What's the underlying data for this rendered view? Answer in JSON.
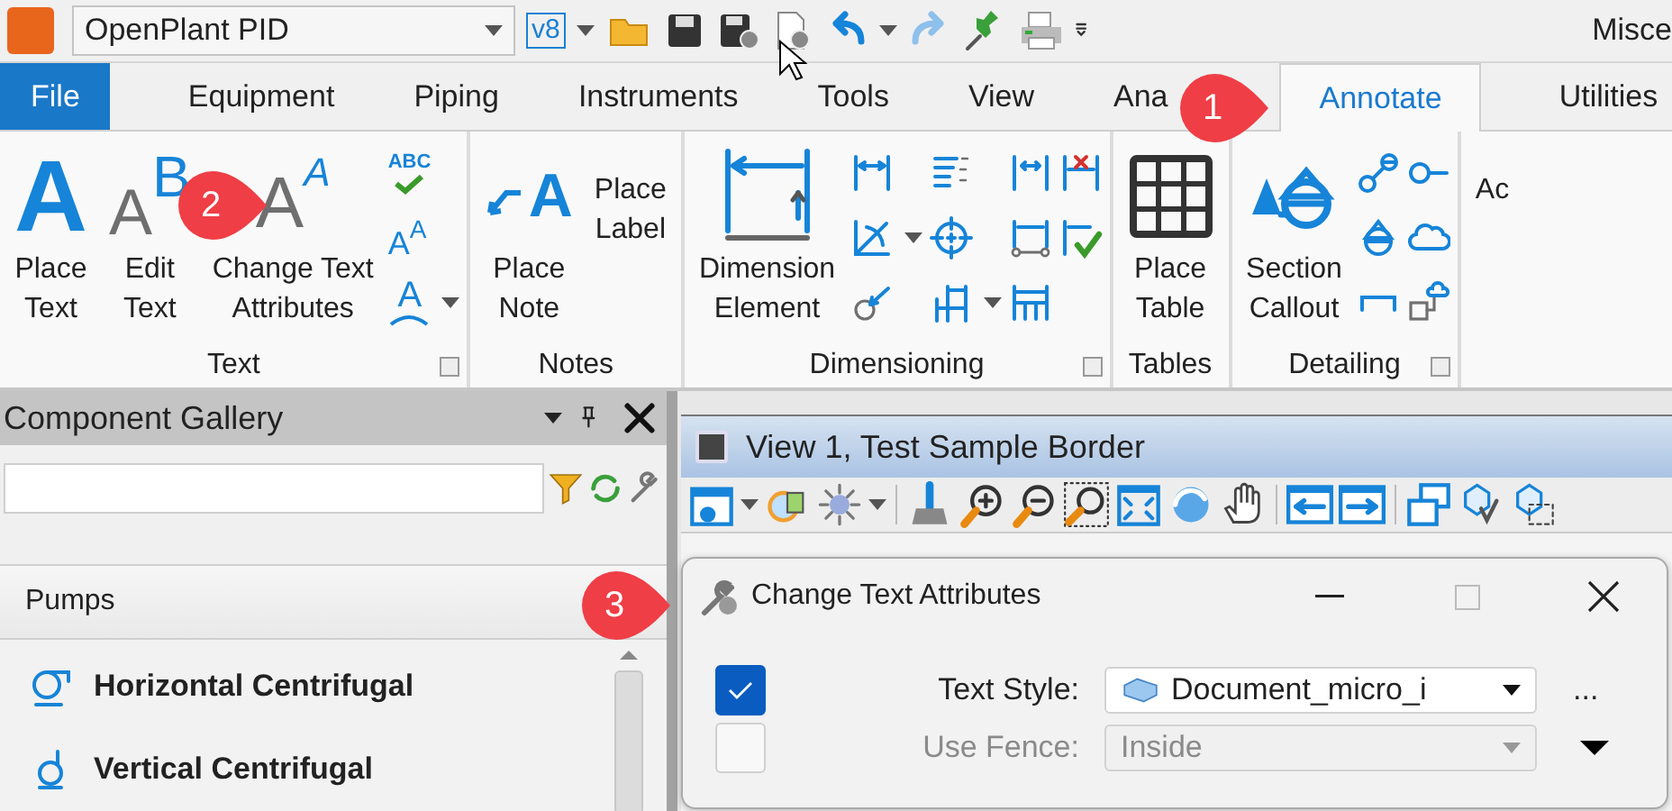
{
  "quick_access": {
    "workflow": "OpenPlant PID",
    "version_badge": "v8",
    "title_fragment": "Misce"
  },
  "ribbon_tabs": [
    {
      "label": "File",
      "kind": "backstage",
      "selected": false
    },
    {
      "label": "Equipment",
      "kind": "tab",
      "selected": false
    },
    {
      "label": "Piping",
      "kind": "tab",
      "selected": false
    },
    {
      "label": "Instruments",
      "kind": "tab",
      "selected": false
    },
    {
      "label": "Tools",
      "kind": "tab",
      "selected": false
    },
    {
      "label": "View",
      "kind": "tab",
      "selected": false
    },
    {
      "label": "Ana",
      "kind": "tab",
      "selected": false
    },
    {
      "label": "Annotate",
      "kind": "tab",
      "selected": true
    },
    {
      "label": "Utilities",
      "kind": "tab",
      "selected": false
    }
  ],
  "ribbon_groups": [
    {
      "title": "Text",
      "launcher": true,
      "items": [
        {
          "kind": "large",
          "glyphs": [
            "A"
          ],
          "lines": [
            "Place",
            "Text"
          ]
        },
        {
          "kind": "large",
          "glyphs": [
            "A",
            "B"
          ],
          "lines": [
            "Edit",
            "Text"
          ]
        },
        {
          "kind": "large",
          "glyphs": [
            "A",
            "A"
          ],
          "lines": [
            "Change Text",
            "Attributes"
          ]
        },
        {
          "kind": "column",
          "items": [
            {
              "glyphs": [
                "ABC"
              ],
              "dropdown": false
            },
            {
              "glyphs": [
                "A",
                "A"
              ],
              "dropdown": false
            },
            {
              "glyphs": [
                "A"
              ],
              "dropdown": true
            }
          ]
        }
      ]
    },
    {
      "title": "Notes",
      "launcher": false,
      "items": [
        {
          "kind": "large",
          "glyphs": [
            "A"
          ],
          "lines": [
            "Place",
            "Note"
          ]
        },
        {
          "kind": "textonly",
          "lines": [
            "Place",
            "Label"
          ]
        }
      ]
    },
    {
      "title": "Dimensioning",
      "launcher": true,
      "items": [
        {
          "kind": "large",
          "lines": [
            "Dimension",
            "Element"
          ]
        },
        {
          "kind": "column",
          "items": [
            {
              "dropdown": false
            },
            {
              "dropdown": true
            },
            {
              "dropdown": false
            }
          ]
        },
        {
          "kind": "column",
          "items": [
            {
              "dropdown": false
            },
            {
              "dropdown": false
            },
            {
              "dropdown": true
            }
          ]
        },
        {
          "kind": "column",
          "items": [
            {
              "dropdown": false
            },
            {
              "dropdown": false
            },
            {
              "dropdown": false
            }
          ]
        },
        {
          "kind": "column",
          "items": [
            {
              "dropdown": false
            },
            {
              "dropdown": false
            }
          ]
        }
      ]
    },
    {
      "title": "Tables",
      "launcher": false,
      "items": [
        {
          "kind": "large",
          "lines": [
            "Place",
            "Table"
          ]
        }
      ]
    },
    {
      "title": "Detailing",
      "launcher": true,
      "items": [
        {
          "kind": "large",
          "lines": [
            "Section",
            "Callout"
          ]
        },
        {
          "kind": "column",
          "items": [
            {
              "dropdown": false
            },
            {
              "dropdown": false
            },
            {
              "dropdown": false
            }
          ]
        },
        {
          "kind": "column",
          "items": [
            {
              "dropdown": false
            },
            {
              "dropdown": false
            },
            {
              "dropdown": false
            }
          ]
        }
      ]
    },
    {
      "launcher": false,
      "items": [
        {
          "kind": "textonly",
          "lines": [
            "Ac"
          ]
        }
      ]
    }
  ],
  "gallery": {
    "title": "Component Gallery",
    "category": "Pumps",
    "items": [
      {
        "label": "Horizontal Centrifugal"
      },
      {
        "label": "Vertical Centrifugal"
      }
    ]
  },
  "view": {
    "title": "View 1, Test Sample Border"
  },
  "dialog": {
    "title": "Change Text Attributes",
    "rows": [
      {
        "kind": "style",
        "label": "Text Style:",
        "checked": true,
        "disabled": false,
        "value": "Document_micro_i",
        "trailing": "..."
      },
      {
        "kind": "fence",
        "label": "Use Fence:",
        "checked": false,
        "disabled": true,
        "value": "Inside"
      }
    ]
  },
  "callouts": [
    {
      "number": "1"
    },
    {
      "number": "2"
    },
    {
      "number": "3"
    }
  ]
}
